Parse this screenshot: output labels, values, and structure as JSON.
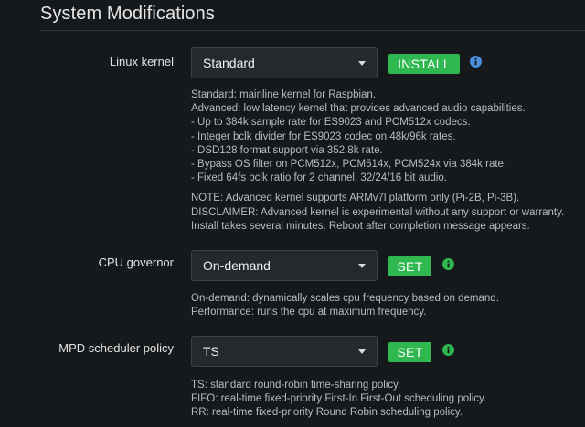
{
  "section": {
    "title": "System Modifications"
  },
  "kernel": {
    "label": "Linux kernel",
    "selected": "Standard",
    "button": "INSTALL",
    "help_lines": [
      "Standard: mainline kernel for Raspbian.",
      "Advanced: low latency kernel that provides advanced audio capabilities.",
      "- Up to 384k sample rate for ES9023 and PCM512x codecs.",
      "- Integer bclk divider for ES9023 codec on 48k/96k rates.",
      "- DSD128 format support via 352.8k rate.",
      "- Bypass OS filter on PCM512x, PCM514x, PCM524x via 384k rate.",
      "- Fixed 64fs bclk ratio for 2 channel, 32/24/16 bit audio."
    ],
    "note_lines": [
      "NOTE: Advanced kernel supports ARMv7l platform only (Pi-2B, Pi-3B).",
      "DISCLAIMER: Advanced kernel is experimental without any support or warranty.",
      "Install takes several minutes. Reboot after completion message appears."
    ]
  },
  "cpu": {
    "label": "CPU governor",
    "selected": "On-demand",
    "button": "SET",
    "help_lines": [
      "On-demand: dynamically scales cpu frequency based on demand.",
      "Performance: runs the cpu at maximum frequency."
    ]
  },
  "mpd": {
    "label": "MPD scheduler policy",
    "selected": "TS",
    "button": "SET",
    "help_lines": [
      "TS: standard round-robin time-sharing policy.",
      "FIFO: real-time fixed-priority First-In First-Out scheduling policy.",
      "RR: real-time fixed-priority Round Robin scheduling policy."
    ]
  },
  "colors": {
    "background": "#16191c",
    "button_green": "#2eb84f",
    "info_blue": "#4a90d9",
    "info_green": "#2eb84f"
  },
  "icons": {
    "kernel_info": "info-circle-icon",
    "cpu_info": "info-circle-icon",
    "mpd_info": "info-circle-icon",
    "dropdown": "caret-down-icon"
  }
}
